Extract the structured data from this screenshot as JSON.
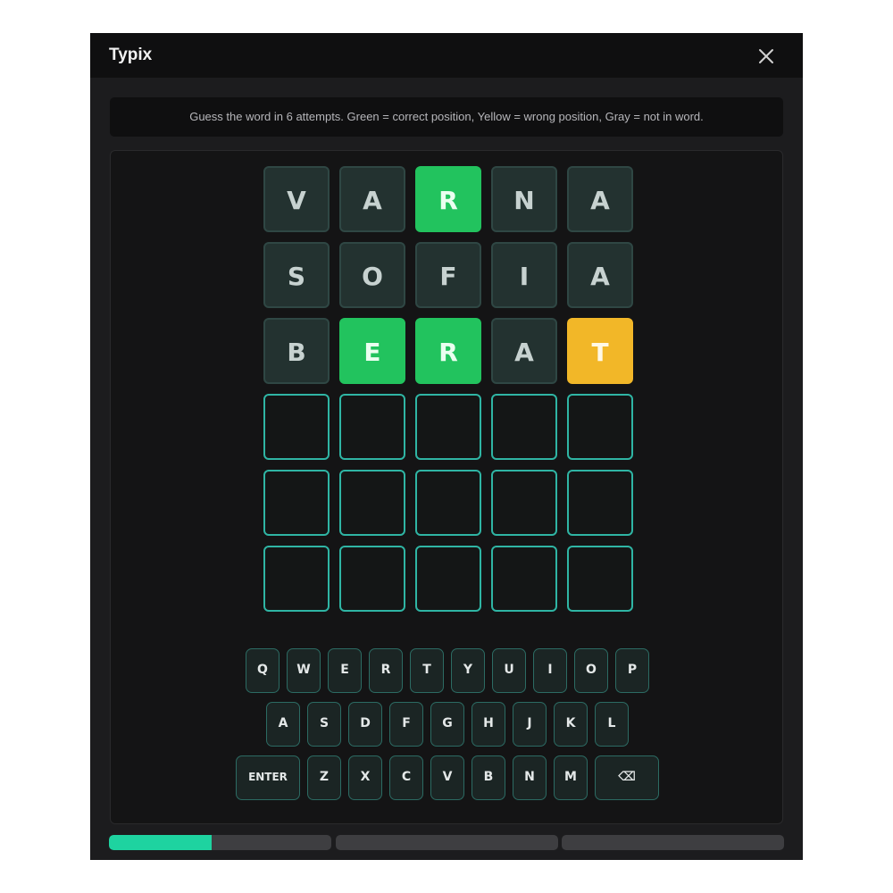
{
  "app": {
    "title": "Typix",
    "close_icon": "close-icon"
  },
  "instructions": "Guess the word in 6 attempts. Green = correct position, Yellow = wrong position, Gray = not in word.",
  "colors": {
    "correct": "#22c35e",
    "present": "#f2b728",
    "absent": "#233230",
    "empty_border": "#2fb5a4",
    "progress": "#1ed3a0"
  },
  "board": {
    "rows": [
      [
        {
          "letter": "V",
          "state": "absent"
        },
        {
          "letter": "A",
          "state": "absent"
        },
        {
          "letter": "R",
          "state": "correct"
        },
        {
          "letter": "N",
          "state": "absent"
        },
        {
          "letter": "A",
          "state": "absent"
        }
      ],
      [
        {
          "letter": "S",
          "state": "absent"
        },
        {
          "letter": "O",
          "state": "absent"
        },
        {
          "letter": "F",
          "state": "absent"
        },
        {
          "letter": "I",
          "state": "absent"
        },
        {
          "letter": "A",
          "state": "absent"
        }
      ],
      [
        {
          "letter": "B",
          "state": "absent"
        },
        {
          "letter": "E",
          "state": "correct"
        },
        {
          "letter": "R",
          "state": "correct"
        },
        {
          "letter": "A",
          "state": "absent"
        },
        {
          "letter": "T",
          "state": "present"
        }
      ],
      [
        {
          "letter": "",
          "state": "empty"
        },
        {
          "letter": "",
          "state": "empty"
        },
        {
          "letter": "",
          "state": "empty"
        },
        {
          "letter": "",
          "state": "empty"
        },
        {
          "letter": "",
          "state": "empty"
        }
      ],
      [
        {
          "letter": "",
          "state": "empty"
        },
        {
          "letter": "",
          "state": "empty"
        },
        {
          "letter": "",
          "state": "empty"
        },
        {
          "letter": "",
          "state": "empty"
        },
        {
          "letter": "",
          "state": "empty"
        }
      ],
      [
        {
          "letter": "",
          "state": "empty"
        },
        {
          "letter": "",
          "state": "empty"
        },
        {
          "letter": "",
          "state": "empty"
        },
        {
          "letter": "",
          "state": "empty"
        },
        {
          "letter": "",
          "state": "empty"
        }
      ]
    ]
  },
  "keyboard": {
    "rows": [
      [
        "Q",
        "W",
        "E",
        "R",
        "T",
        "Y",
        "U",
        "I",
        "O",
        "P"
      ],
      [
        "A",
        "S",
        "D",
        "F",
        "G",
        "H",
        "J",
        "K",
        "L"
      ],
      [
        "ENTER",
        "Z",
        "X",
        "C",
        "V",
        "B",
        "N",
        "M",
        "⌫"
      ]
    ]
  },
  "progress": {
    "segments": [
      {
        "fill": 0.46
      },
      {
        "fill": 0
      },
      {
        "fill": 0
      }
    ]
  }
}
